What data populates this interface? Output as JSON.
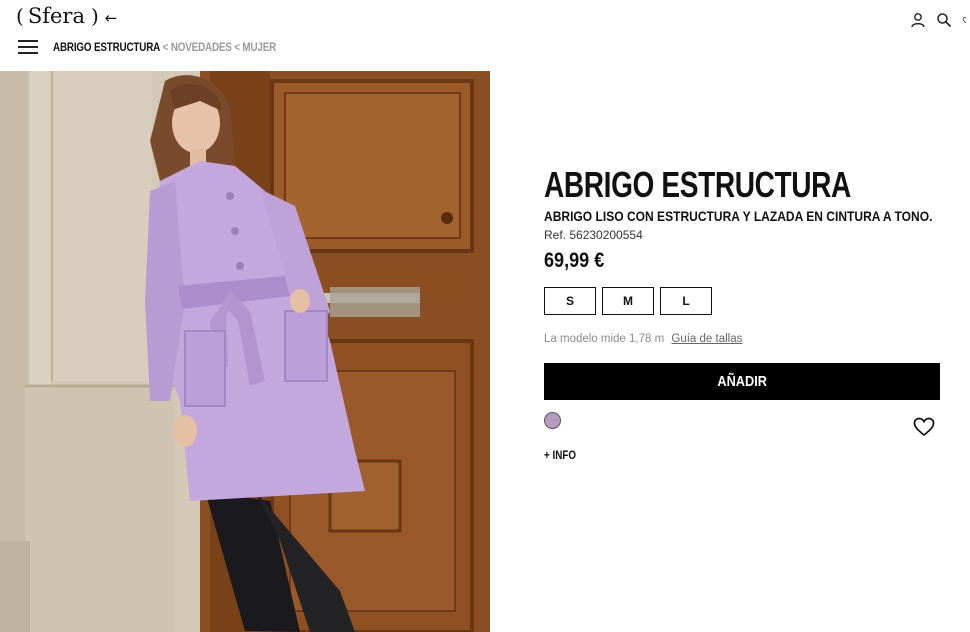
{
  "header": {
    "logo": "Sfera",
    "back_arrow": "←",
    "icons": [
      "user-icon",
      "search-icon",
      "heart-icon"
    ]
  },
  "breadcrumb": {
    "current": "ABRIGO ESTRUCTURA",
    "separator": "<",
    "crumbs": [
      "NOVEDADES",
      "MUJER"
    ]
  },
  "product": {
    "title": "ABRIGO ESTRUCTURA",
    "subtitle": "ABRIGO LISO CON ESTRUCTURA Y LAZADA EN CINTURA A TONO.",
    "ref": "Ref. 56230200554",
    "price": "69,99 €",
    "sizes": [
      "S",
      "M",
      "L"
    ],
    "model_note": "La modelo mide 1,78 m",
    "size_guide": "Guía de tallas",
    "add_button": "AÑADIR",
    "color_swatch": "#b69bbf",
    "more_info": "+ INFO"
  }
}
